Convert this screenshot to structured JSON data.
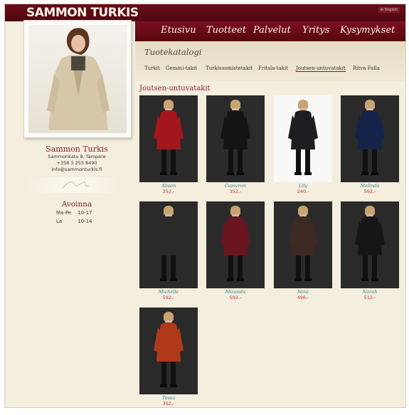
{
  "brand": "SAMMON TURKIS",
  "lang_link": "In English",
  "nav": [
    "Etusivu",
    "Tuotteet",
    "Palvelut",
    "Yritys",
    "Kysymykset"
  ],
  "sidebar": {
    "name": "Sammon Turkis",
    "address": "Sammonkatu 8, Tampere",
    "phone": "+358 3 255 8490",
    "email": "info@sammonturkis.fi",
    "open_title": "Avoinna",
    "hours": [
      {
        "days": "Ma-Pe",
        "time": "10-17"
      },
      {
        "days": "La",
        "time": "10-14"
      }
    ]
  },
  "catalog": {
    "title": "Tuotekatalogi",
    "tabs": [
      "Turkit",
      "Gemini-takit",
      "Turkissomistetakit",
      "Fritsla-takit",
      "Joutsen-untuvatakit",
      "Ritva Falla"
    ],
    "active_tab": "Joutsen-untuvatakit",
    "section_title": "Joutsen-untuvatakit"
  },
  "products": [
    {
      "name": "Alison",
      "price": "352,-",
      "coat": "#a3161d",
      "bg": "#2a2a2a"
    },
    {
      "name": "Cameron",
      "price": "352,-",
      "coat": "#141414",
      "bg": "#2b2b2b"
    },
    {
      "name": "Lily",
      "price": "240,-",
      "coat": "#1e1e22",
      "bg": "#f8f8f6"
    },
    {
      "name": "Melinda",
      "price": "592,-",
      "coat": "#15234a",
      "bg": "#2a2a2a"
    },
    {
      "name": "Michelle",
      "price": "592,-",
      "coat": "#2a2a28",
      "bg": "#2a2a2a"
    },
    {
      "name": "Miranda",
      "price": "592,-",
      "coat": "#6a1420",
      "bg": "#2b2b2b"
    },
    {
      "name": "Nina",
      "price": "496,-",
      "coat": "#3e2a22",
      "bg": "#2b2b2b"
    },
    {
      "name": "Norah",
      "price": "512,-",
      "coat": "#161616",
      "bg": "#2a2a2a"
    },
    {
      "name": "Tessa",
      "price": "352,-",
      "coat": "#b0391a",
      "bg": "#2a2a2a"
    }
  ]
}
